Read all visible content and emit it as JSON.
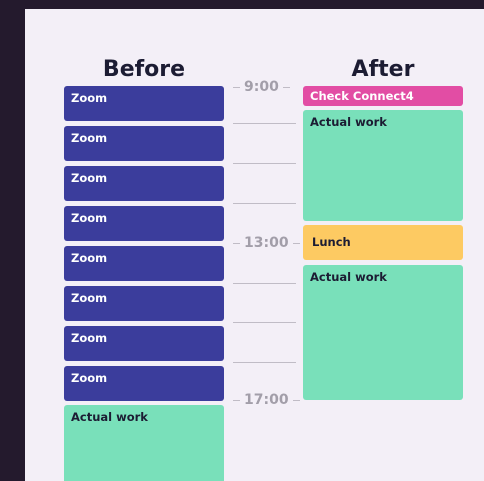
{
  "before": {
    "title": "Before",
    "blocks": [
      {
        "label": "Zoom",
        "kind": "zoom"
      },
      {
        "label": "Zoom",
        "kind": "zoom"
      },
      {
        "label": "Zoom",
        "kind": "zoom"
      },
      {
        "label": "Zoom",
        "kind": "zoom"
      },
      {
        "label": "Zoom",
        "kind": "zoom"
      },
      {
        "label": "Zoom",
        "kind": "zoom"
      },
      {
        "label": "Zoom",
        "kind": "zoom"
      },
      {
        "label": "Zoom",
        "kind": "zoom"
      },
      {
        "label": "Actual work",
        "kind": "work"
      }
    ]
  },
  "after": {
    "title": "After",
    "blocks": [
      {
        "label": "Check Connect4",
        "kind": "check"
      },
      {
        "label": "Actual work",
        "kind": "work"
      },
      {
        "label": "Lunch",
        "kind": "lunch"
      },
      {
        "label": "Actual work",
        "kind": "work"
      }
    ]
  },
  "times": [
    "9:00",
    "13:00",
    "17:00"
  ],
  "colors": {
    "zoom": "#3b3d9c",
    "work": "#79e0ba",
    "lunch": "#fdca62",
    "check": "#e24da4",
    "background": "#f3eff7",
    "frame": "#241a2d"
  }
}
